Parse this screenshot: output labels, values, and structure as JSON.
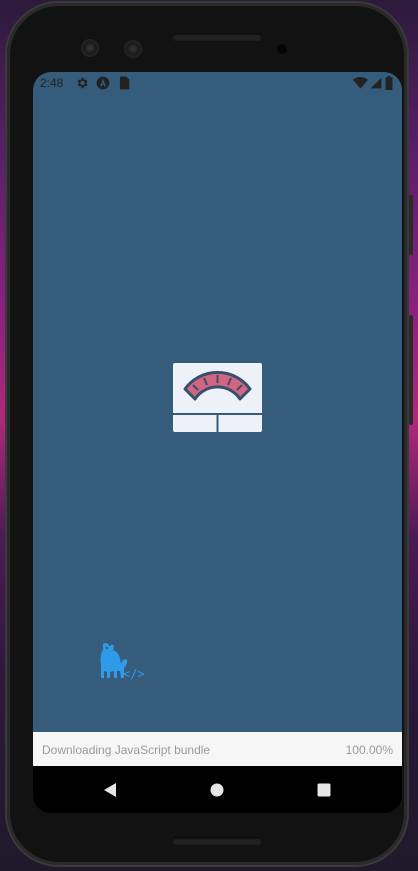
{
  "status_bar": {
    "time": "2:48",
    "left_icons": [
      "settings-gear-icon",
      "app-a-icon",
      "sim-card-icon"
    ],
    "right_icons": [
      "wifi-icon",
      "signal-icon",
      "battery-icon"
    ]
  },
  "app": {
    "background": "#355c7a",
    "logo": "weighing-scale-icon",
    "brand_logo": "cat-code-icon"
  },
  "download_bar": {
    "message": "Downloading JavaScript bundle",
    "progress": "100.00%"
  },
  "nav_bar": {
    "buttons": [
      "back-button",
      "home-button",
      "recents-button"
    ]
  }
}
